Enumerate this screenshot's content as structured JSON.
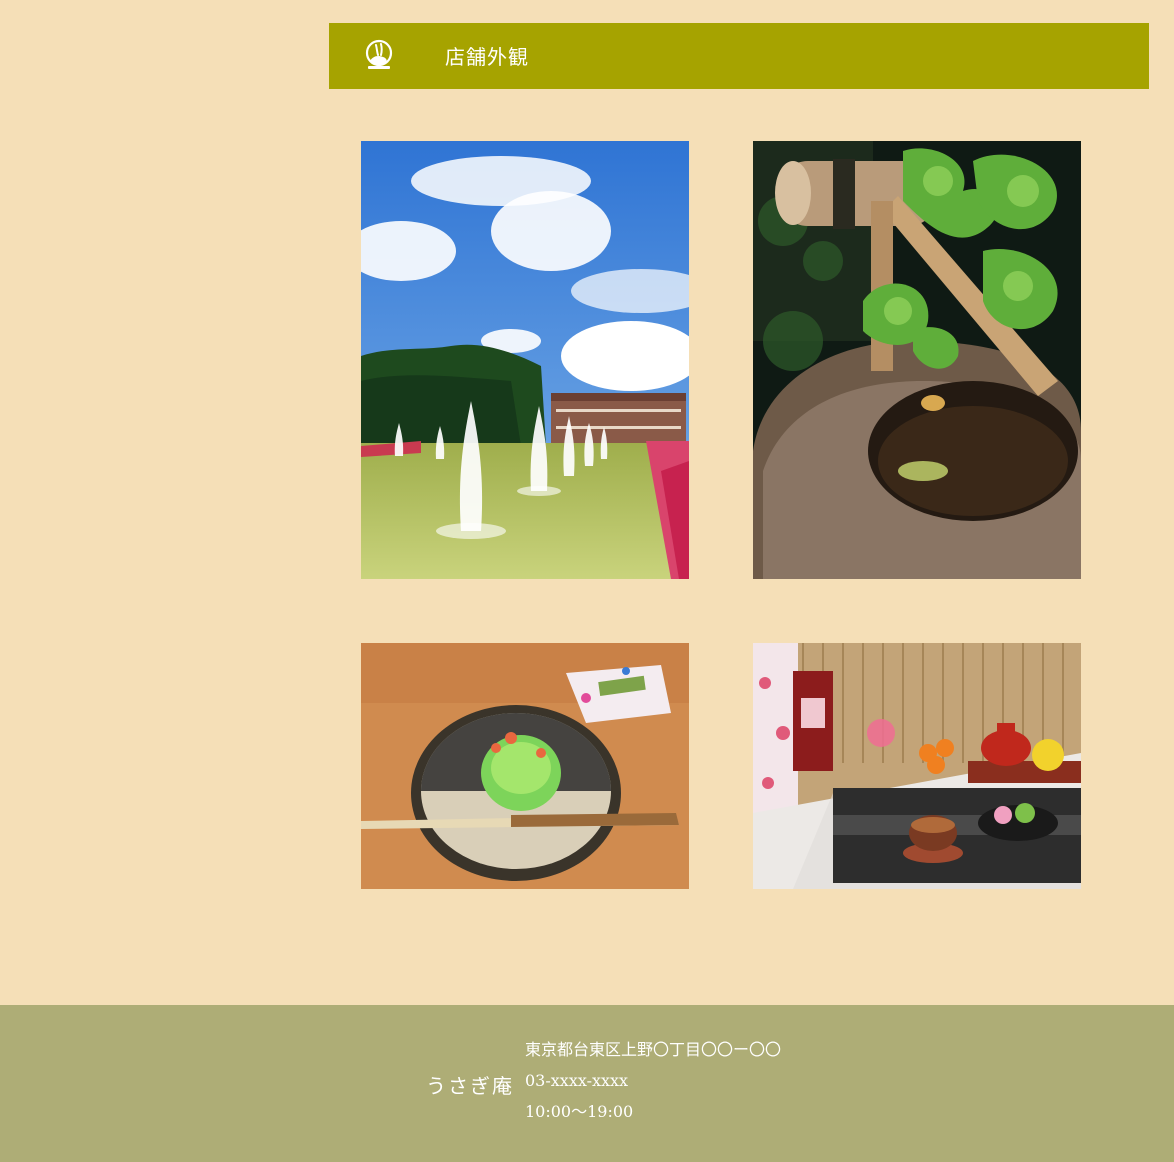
{
  "section": {
    "title": "店舗外観",
    "icon": "rabbit-icon"
  },
  "gallery": [
    {
      "name": "fountain-photo",
      "subject": "fountain park with museum"
    },
    {
      "name": "tsukubai-photo",
      "subject": "bamboo water spout and stone basin"
    },
    {
      "name": "wagashi-photo",
      "subject": "green wagashi on plate with pick"
    },
    {
      "name": "tea-set-photo",
      "subject": "tea cup and sweets on counter"
    }
  ],
  "footer": {
    "shop_name": "うさぎ庵",
    "address": "東京都台東区上野〇丁目〇〇ー〇〇",
    "phone": "03-xxxx-xxxx",
    "hours": "10:00〜19:00"
  },
  "colors": {
    "page_bg": "#f5dfb7",
    "header_bg": "#a6a300",
    "footer_bg": "#aead76",
    "text_light": "#ffffff"
  }
}
